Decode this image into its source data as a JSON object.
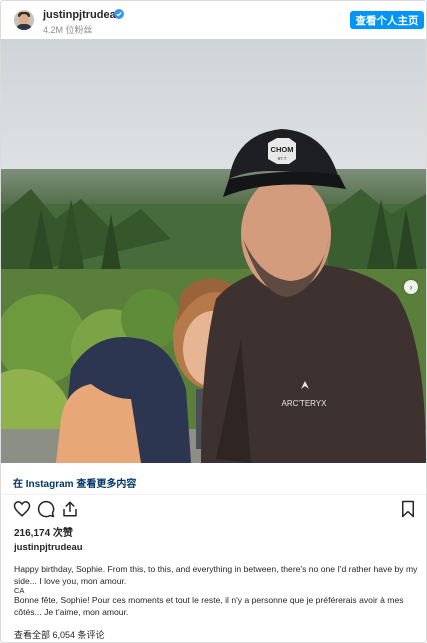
{
  "header": {
    "username": "justinpjtrudeau",
    "followers": "4.2M 位粉丝",
    "view_profile_label": "查看个人主页"
  },
  "photo": {
    "cap_logo_top": "CHOM",
    "cap_logo_bottom": "97.7",
    "jacket_brand": "ARC'TERYX",
    "slide_count": 2,
    "active_slide": 1
  },
  "instagram_link": {
    "label": "在 Instagram 查看更多内容"
  },
  "post": {
    "likes": "216,174 次赞",
    "owner": "justinpjtrudeau",
    "caption_en": "Happy birthday, Sophie. From this, to this, and everything in between, there's no one I'd rather have by my side... I love you, mon amour.",
    "lang_tag": "CA",
    "caption_fr": "Bonne fête, Sophie! Pour ces moments et tout le reste, il n'y a personne que je préférerais avoir à mes côtés... Je t'aime, mon amour.",
    "comments_link": "查看全部 6,054 条评论"
  },
  "colors": {
    "accent": "#0095f6",
    "link": "#00376b",
    "muted": "#8e8e8e"
  }
}
